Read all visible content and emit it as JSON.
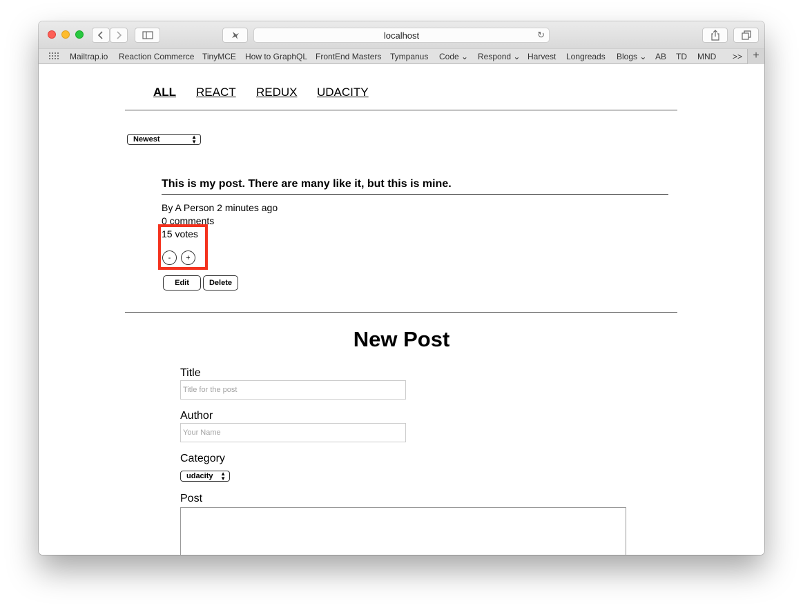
{
  "browser": {
    "url": "localhost",
    "bookmarks": [
      "Mailtrap.io",
      "Reaction Commerce",
      "TinyMCE",
      "How to GraphQL",
      "FrontEnd Masters",
      "Tympanus",
      "Code",
      "Respond",
      "Harvest",
      "Longreads",
      "Blogs",
      "AB",
      "TD",
      "MND"
    ],
    "overflow_label": ">>"
  },
  "nav": {
    "items": [
      "ALL",
      "REACT",
      "REDUX",
      "UDACITY"
    ],
    "active": "ALL"
  },
  "sort": {
    "selected": "Newest"
  },
  "post": {
    "title": "This is my post. There are many like it, but this is mine.",
    "byline": "By A Person 2 minutes ago",
    "comments": "0 comments",
    "votes": "15 votes",
    "downvote_label": "-",
    "upvote_label": "+",
    "edit_label": "Edit",
    "delete_label": "Delete"
  },
  "new_post": {
    "heading": "New Post",
    "title_label": "Title",
    "title_placeholder": "Title for the post",
    "author_label": "Author",
    "author_placeholder": "Your Name",
    "category_label": "Category",
    "category_selected": "udacity",
    "post_label": "Post"
  }
}
